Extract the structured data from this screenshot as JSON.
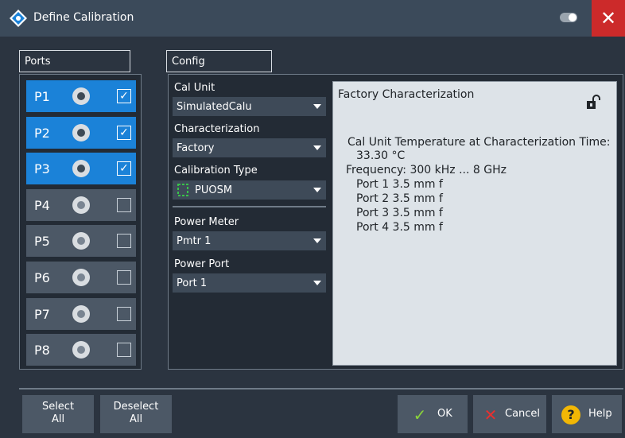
{
  "window": {
    "title": "Define Calibration"
  },
  "ports_panel": {
    "header": "Ports",
    "ports": [
      {
        "label": "P1",
        "selected": true,
        "checked": true
      },
      {
        "label": "P2",
        "selected": true,
        "checked": true
      },
      {
        "label": "P3",
        "selected": true,
        "checked": true
      },
      {
        "label": "P4",
        "selected": false,
        "checked": false
      },
      {
        "label": "P5",
        "selected": false,
        "checked": false
      },
      {
        "label": "P6",
        "selected": false,
        "checked": false
      },
      {
        "label": "P7",
        "selected": false,
        "checked": false
      },
      {
        "label": "P8",
        "selected": false,
        "checked": false
      }
    ]
  },
  "config_panel": {
    "header": "Config",
    "cal_unit": {
      "label": "Cal Unit",
      "value": "SimulatedCalu"
    },
    "characterization": {
      "label": "Characterization",
      "value": "Factory"
    },
    "calibration_type": {
      "label": "Calibration Type",
      "value": "PUOSM"
    },
    "power_meter": {
      "label": "Power Meter",
      "value": "Pmtr 1"
    },
    "power_port": {
      "label": "Power Port",
      "value": "Port 1"
    }
  },
  "info_panel": {
    "title": "Factory Characterization",
    "lines": [
      "Cal Unit Temperature at Characterization Time:",
      "33.30 °C",
      "Frequency: 300 kHz ... 8 GHz",
      "Port 1 3.5 mm f",
      "Port 2 3.5 mm f",
      "Port 3 3.5 mm f",
      "Port 4 3.5 mm f"
    ]
  },
  "buttons": {
    "select_all": {
      "line1": "Select",
      "line2": "All"
    },
    "deselect_all": {
      "line1": "Deselect",
      "line2": "All"
    },
    "ok": "OK",
    "cancel": "Cancel",
    "help": "Help"
  },
  "colors": {
    "background": "#2b3440",
    "titlebar": "#3b4a5a",
    "selected_port": "#1b82d8",
    "close_button": "#cc2a2a",
    "ok_check": "#8bd43a",
    "cancel_x": "#e8302f",
    "help_icon": "#f2b705",
    "calibration_type_icon": "#39c24a"
  },
  "icons": [
    "app-logo-icon",
    "toggle-icon",
    "close-icon",
    "connector-icon",
    "checkbox-check-icon",
    "chevron-down-icon",
    "calibration-type-icon",
    "lock-open-icon",
    "check-icon",
    "x-icon",
    "help-icon"
  ]
}
